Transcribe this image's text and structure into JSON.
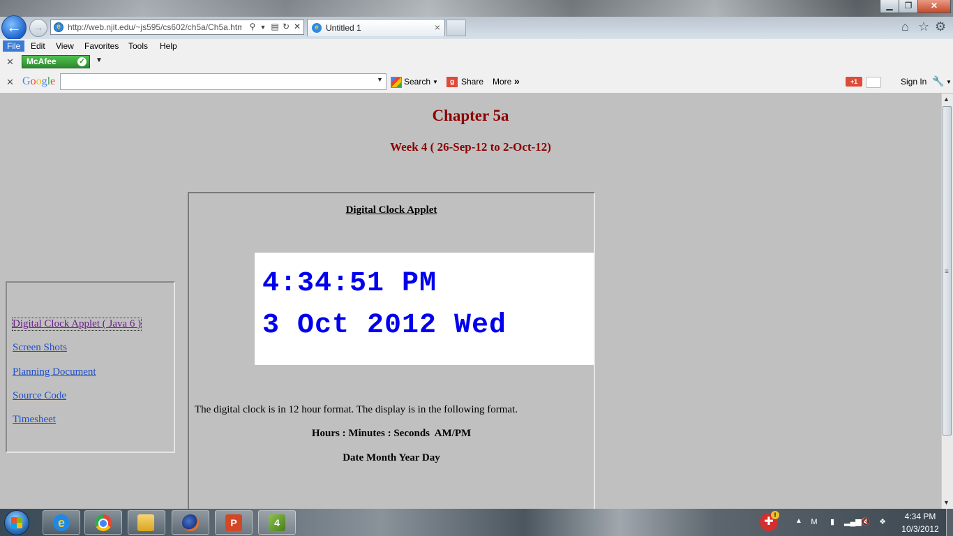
{
  "browser": {
    "url": "http://web.njit.edu/~js595/cs602/ch5a/Ch5a.htm",
    "tab_title": "Untitled 1",
    "window_controls": [
      "minimize",
      "maximize",
      "close"
    ],
    "menu": [
      "File",
      "Edit",
      "View",
      "Favorites",
      "Tools",
      "Help"
    ],
    "mcafee_label": "McAfee",
    "google": {
      "logo": "Google",
      "search_label": "Search",
      "share_label": "Share",
      "more_label": "More",
      "more_chevrons": "»",
      "signin_label": "Sign In",
      "gplus_label": "+1"
    }
  },
  "page": {
    "chapter_title": "Chapter 5a",
    "week_title": "Week 4 ( 26-Sep-12 to 2-Oct-12)",
    "applet_heading": "Digital Clock Applet",
    "clock_time": "4:34:51 PM",
    "clock_date": "3 Oct 2012 Wed",
    "sidebar_links": [
      "Digital Clock Applet ( Java 6 )",
      "Screen Shots",
      "Planning Document",
      "Source Code",
      "Timesheet"
    ],
    "description": "The digital clock is in 12 hour format. The display is in the following format.",
    "format_line_1": "Hours : Minutes : Seconds  AM/PM",
    "format_line_2": "Date Month Year Day"
  },
  "taskbar": {
    "apps": [
      "internet-explorer",
      "chrome",
      "windows-explorer",
      "firefox",
      "powerpoint",
      "photoshop-elements"
    ],
    "app_glyph_4": "4",
    "time": "4:34 PM",
    "date": "10/3/2012"
  },
  "colors": {
    "page_background": "#c0c0c0",
    "heading_red": "#8b0000",
    "clock_blue": "#0000ee",
    "link_blue": "#1f4fc8",
    "visited_purple": "#6a1b8a"
  }
}
